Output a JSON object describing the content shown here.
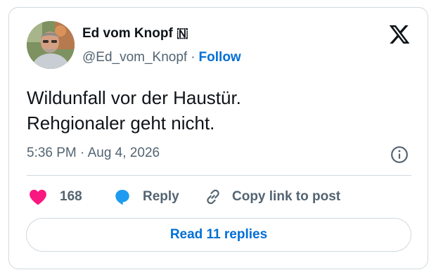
{
  "author": {
    "display_name": "Ed vom Knopf 🇳",
    "handle": "@Ed_vom_Knopf",
    "separator": "·",
    "follow_label": "Follow"
  },
  "brand": {
    "logo_icon": "x-logo-icon"
  },
  "tweet": {
    "lines": [
      "Wildunfall vor der Haustür.",
      "Rehgionaler geht nicht."
    ],
    "timestamp": "5:36 PM · Aug 4, 2026"
  },
  "actions": {
    "like_count": "168",
    "reply_label": "Reply",
    "copy_label": "Copy link to post"
  },
  "footer": {
    "read_replies_label": "Read 11 replies"
  },
  "colors": {
    "like": "#f91880",
    "reply": "#1d9bf0",
    "link": "#006fd6",
    "muted": "#536471",
    "border": "#cfd9de"
  }
}
